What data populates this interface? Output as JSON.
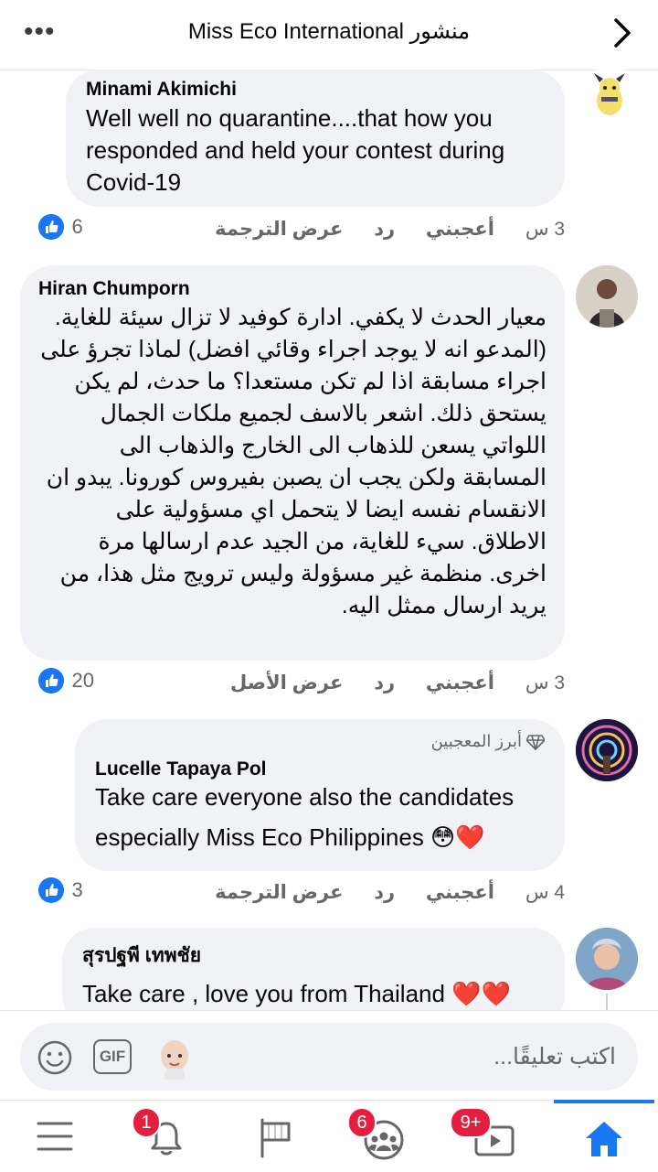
{
  "header": {
    "more_icon_text": "•••",
    "title": "Miss Eco International منشور"
  },
  "comments": [
    {
      "author": "Minami Akimichi",
      "text": "Well well no quarantine....that how you responded and held your contest during Covid-19",
      "time": "3 س",
      "like": "أعجبني",
      "reply": "رد",
      "extra": "عرض الترجمة",
      "likes": "6"
    },
    {
      "author": "Hiran Chumporn",
      "text": "معيار الحدث لا يكفي. ادارة كوفيد لا تزال سيئة للغاية. (المدعو انه لا يوجد اجراء وقائي افضل) لماذا تجرؤ على اجراء مسابقة اذا لم تكن مستعدا؟ ما حدث، لم يكن يستحق ذلك. اشعر بالاسف لجميع ملكات الجمال اللواتي يسعن للذهاب الى الخارج والذهاب الى المسابقة ولكن يجب ان يصبن بفيروس كورونا. يبدو ان الانقسام نفسه ايضا لا يتحمل اي مسؤولية على الاطلاق. سيء للغاية، من الجيد عدم ارسالها مرة اخرى. منظمة غير مسؤولة وليس ترويج مثل هذا، من يريد ارسال ممثل اليه.",
      "time": "3 س",
      "like": "أعجبني",
      "reply": "رد",
      "extra": "عرض الأصل",
      "likes": "20"
    },
    {
      "badge": "أبرز المعجبين",
      "author": "Lucelle Tapaya Pol",
      "text": "Take care everyone also the candidates especially Miss Eco Philippines 😳❤️",
      "time": "4 س",
      "like": "أعجبني",
      "reply": "رد",
      "extra": "عرض الترجمة",
      "likes": "3"
    },
    {
      "author": "สุรปฐพี เทพชัย",
      "text": "Take care , love you from Thailand ❤️❤️"
    }
  ],
  "composer": {
    "placeholder": "اكتب تعليقًا...",
    "gif_label": "GIF"
  },
  "nav": {
    "notifications_badge": "1",
    "groups_badge": "6",
    "watch_badge": "9+"
  },
  "colors": {
    "accent": "#1877f2",
    "bubble": "#f0f2f5",
    "badge": "#e41e3f"
  }
}
